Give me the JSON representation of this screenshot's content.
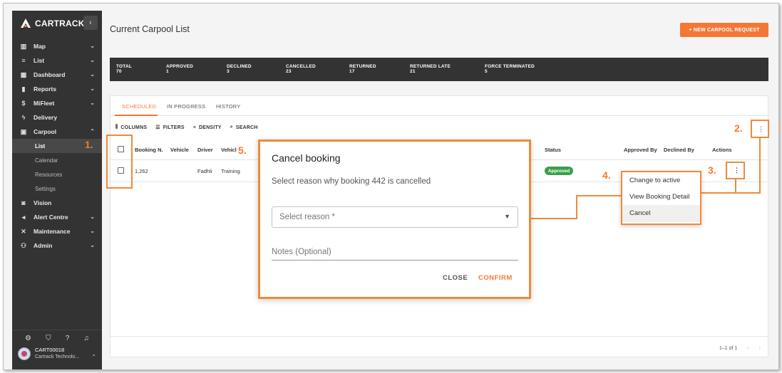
{
  "brand": {
    "name": "CARTRACK"
  },
  "sidebar": {
    "collapse_icon": "chevron-left-icon",
    "items": [
      {
        "label": "Map",
        "icon": "map-icon"
      },
      {
        "label": "List",
        "icon": "list-icon"
      },
      {
        "label": "Dashboard",
        "icon": "dashboard-icon"
      },
      {
        "label": "Reports",
        "icon": "bar-chart-icon"
      },
      {
        "label": "MiFleet",
        "icon": "dollar-icon"
      },
      {
        "label": "Delivery",
        "icon": "lightning-icon"
      },
      {
        "label": "Carpool",
        "icon": "calendar-icon"
      }
    ],
    "carpool_sub": [
      "List",
      "Calendar",
      "Resources",
      "Settings"
    ],
    "items_after": [
      {
        "label": "Vision",
        "icon": "camera-icon"
      },
      {
        "label": "Alert Centre",
        "icon": "megaphone-icon"
      },
      {
        "label": "Maintenance",
        "icon": "tools-icon"
      },
      {
        "label": "Admin",
        "icon": "users-icon"
      }
    ],
    "user": {
      "id": "CART00018",
      "company": "Cartrack Technolo..."
    }
  },
  "header": {
    "title": "Current Carpool List",
    "new_button": "+ NEW CARPOOL REQUEST"
  },
  "stats": [
    {
      "label": "TOTAL",
      "value": "70"
    },
    {
      "label": "APPROVED",
      "value": "1"
    },
    {
      "label": "DECLINED",
      "value": "3"
    },
    {
      "label": "CANCELLED",
      "value": "23"
    },
    {
      "label": "RETURNED",
      "value": "17"
    },
    {
      "label": "RETURNED LATE",
      "value": "21"
    },
    {
      "label": "FORCE TERMINATED",
      "value": "5"
    }
  ],
  "tabs": [
    "SCHEDULED",
    "IN PROGRESS",
    "HISTORY"
  ],
  "toolbar": {
    "columns": "COLUMNS",
    "filters": "FILTERS",
    "density": "DENSITY",
    "search": "SEARCH"
  },
  "table": {
    "headers": [
      "Booking N.",
      "Vehicle",
      "Driver",
      "Vehicl",
      "Status",
      "Approved By",
      "Declined By",
      "Actions"
    ],
    "row": {
      "booking": "1,262",
      "driver": "Fadhli",
      "vehicle_type": "Training",
      "status": "Approved"
    }
  },
  "pagination": {
    "text": "1–1 of 1"
  },
  "dialog": {
    "title": "Cancel booking",
    "subtitle": "Select reason why booking 442 is cancelled",
    "select_placeholder": "Select reason *",
    "notes_placeholder": "Notes (Optional)",
    "close": "CLOSE",
    "confirm": "CONFIRM"
  },
  "action_menu": [
    "Change to active",
    "View Booking Detail",
    "Cancel"
  ],
  "steps": [
    "1.",
    "2.",
    "3.",
    "4.",
    "5."
  ],
  "colors": {
    "accent": "#f47735",
    "sidebar": "#333333",
    "approved": "#3aa04a",
    "highlight": "#f08a3a"
  }
}
